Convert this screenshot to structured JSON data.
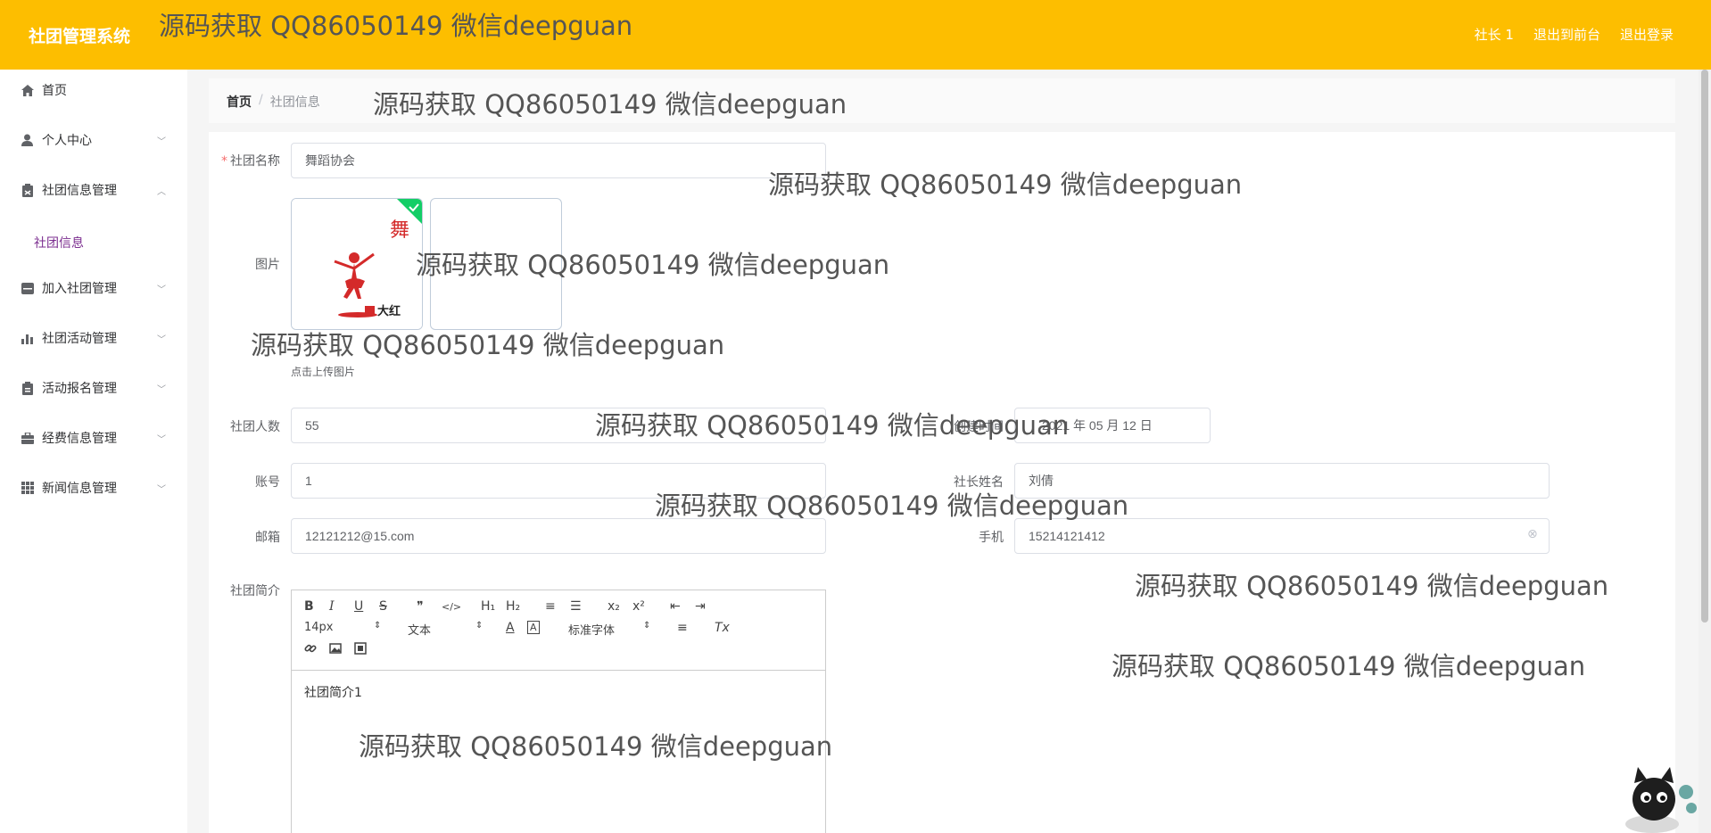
{
  "header": {
    "title": "社团管理系统",
    "links": [
      "社长 1",
      "退出到前台",
      "退出登录"
    ]
  },
  "sidebar": {
    "items": [
      {
        "label": "首页",
        "icon": "home-icon"
      },
      {
        "label": "个人中心",
        "icon": "user-icon"
      },
      {
        "label": "社团信息管理",
        "icon": "clipboard-icon"
      },
      {
        "label": "加入社团管理",
        "icon": "tray-icon"
      },
      {
        "label": "社团活动管理",
        "icon": "bar-chart-icon"
      },
      {
        "label": "活动报名管理",
        "icon": "clipboard-icon"
      },
      {
        "label": "经费信息管理",
        "icon": "briefcase-icon"
      },
      {
        "label": "新闻信息管理",
        "icon": "grid-icon"
      }
    ],
    "active_sub": "社团信息"
  },
  "breadcrumb": {
    "home": "首页",
    "sep": "/",
    "current": "社团信息"
  },
  "form": {
    "name_label": "社团名称",
    "name_value": "舞蹈协会",
    "image_label": "图片",
    "upload_hint": "点击上传图片",
    "image_caption": "大红",
    "image_art": "舞",
    "members_label": "社团人数",
    "members_value": "55",
    "created_label": "创建时间",
    "created_value": "2021 年 05 月 12 日",
    "account_label": "账号",
    "account_value": "1",
    "leader_label": "社长姓名",
    "leader_value": "刘倩",
    "email_label": "邮箱",
    "email_value": "12121212@15.com",
    "phone_label": "手机",
    "phone_value": "15214121412",
    "intro_label": "社团简介",
    "intro_value": "社团简介1"
  },
  "editor": {
    "row1": [
      "B",
      "I",
      "U",
      "S",
      "❞",
      "</>",
      "H₁",
      "H₂",
      "≡",
      "☰",
      "x₂",
      "x²",
      "⇤",
      "⇥"
    ],
    "size": "14px",
    "format": "文本",
    "font": "标准字体",
    "color_a": "A",
    "bg_a": "A",
    "align": "≡",
    "clear": "Tx"
  },
  "watermark": "源码获取 QQ86050149 微信deepguan",
  "colors": {
    "header": "#fdbe00",
    "active": "#7b2d8f",
    "required": "#f56c6c"
  }
}
